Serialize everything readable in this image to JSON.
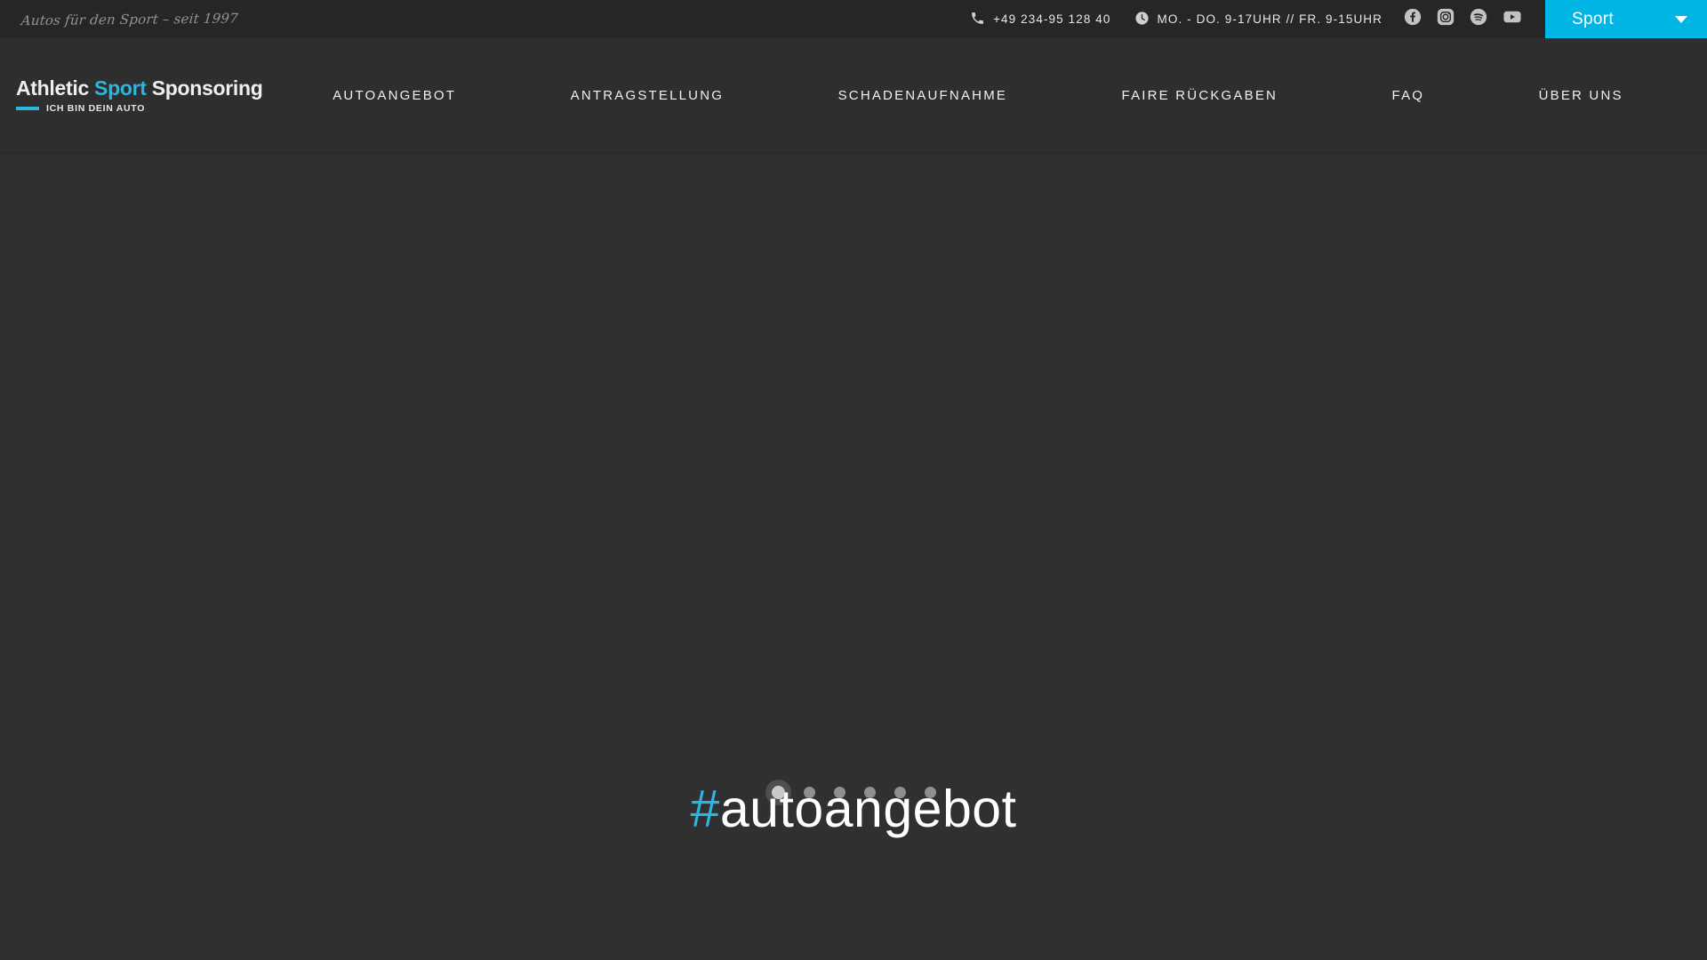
{
  "topbar": {
    "tagline": "Autos für den Sport – seit 1997",
    "phone": {
      "icon": "phone-icon",
      "text": "+49 234-95 128 40"
    },
    "hours": {
      "icon": "clock-icon",
      "text": "MO. - DO. 9-17UHR // FR. 9-15UHR"
    },
    "social": [
      {
        "name": "facebook-icon",
        "label": "Facebook"
      },
      {
        "name": "instagram-icon",
        "label": "Instagram"
      },
      {
        "name": "spotify-icon",
        "label": "Spotify"
      },
      {
        "name": "youtube-icon",
        "label": "YouTube"
      }
    ],
    "language_select": {
      "value": "Sport",
      "icon": "chevron-down-icon"
    }
  },
  "logo": {
    "word1": "Athletic",
    "word2": "Sport",
    "word3": "Sponsoring",
    "subtitle": "ICH BIN DEIN AUTO"
  },
  "nav": {
    "items": [
      {
        "label": "AUTOANGEBOT"
      },
      {
        "label": "ANTRAGSTELLUNG"
      },
      {
        "label": "SCHADENAUFNAHME"
      },
      {
        "label": "FAIRE RÜCKGABEN"
      },
      {
        "label": "FAQ"
      },
      {
        "label": "ÜBER UNS"
      }
    ]
  },
  "hero": {
    "slider": {
      "total_slides": 6,
      "active_index": 0
    },
    "hashtag": {
      "symbol": "#",
      "text": "autoangebot"
    }
  },
  "colors": {
    "accent": "#00b6e4",
    "accent_logo": "#2bb6e0",
    "topbar_bg": "#262626",
    "header_bg": "#2e2e2e",
    "hero_bg": "#303030",
    "text": "#ffffff",
    "muted_text": "#9a9a9a"
  }
}
